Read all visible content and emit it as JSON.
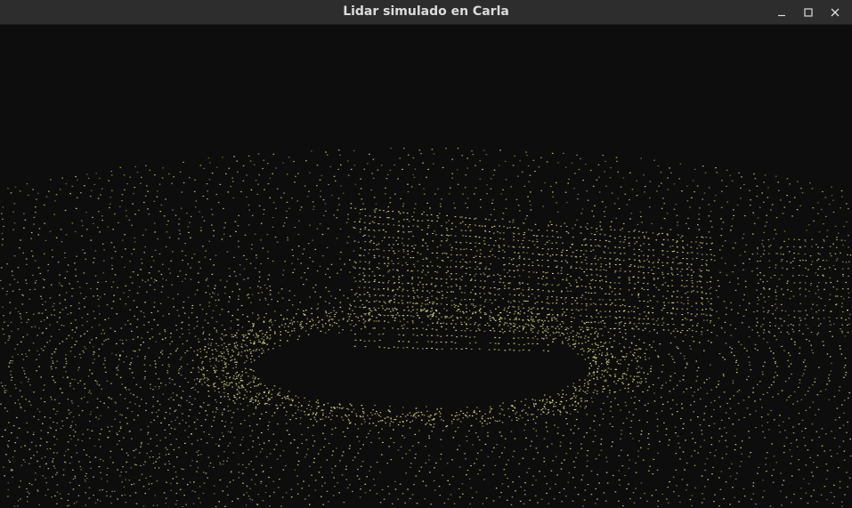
{
  "window": {
    "title": "Lidar simulado en Carla"
  },
  "controls": [
    {
      "name": "minimize-button",
      "icon": "minimize-icon"
    },
    {
      "name": "maximize-button",
      "icon": "maximize-icon"
    },
    {
      "name": "close-button",
      "icon": "close-icon"
    }
  ],
  "viewport": {
    "background": "#0d0d0d",
    "point_color": "#e6e67a",
    "content": "lidar-point-cloud"
  }
}
